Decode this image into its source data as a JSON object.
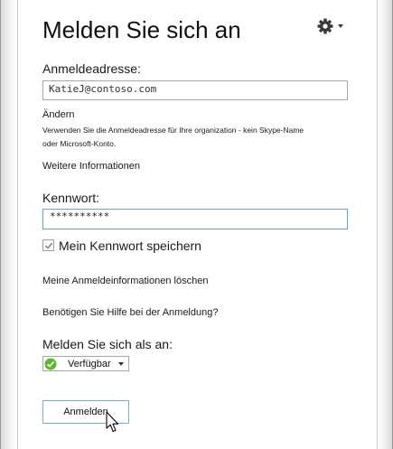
{
  "signin": {
    "title": "Melden Sie sich an",
    "address_label": "Anmeldeadresse:",
    "address_value": "KatieJ@contoso.com",
    "change_link": "Ändern",
    "hint_line1": "Verwenden Sie die Anmeldeadresse für Ihre organization - kein Skype-Name",
    "hint_line2": "oder Microsoft-Konto.",
    "more_info_link": "Weitere Informationen",
    "password_label": "Kennwort:",
    "password_value": "**********",
    "remember_label": "Mein Kennwort speichern",
    "remember_checked": true,
    "delete_info_link": "Meine Anmeldeinformationen löschen",
    "help_link": "Benötigen Sie Hilfe bei der Anmeldung?",
    "signin_as_label": "Melden Sie sich als an:",
    "status_value": "Verfügbar",
    "status_color": "#5cb82e",
    "signin_button": "Anmelden"
  },
  "icons": {
    "settings": "gear-icon",
    "check": "checkmark-icon",
    "presence": "available-presence-icon",
    "cursor": "mouse-pointer-icon"
  },
  "colors": {
    "accent_border": "#5aa6c8",
    "text": "#1a1a1a"
  }
}
